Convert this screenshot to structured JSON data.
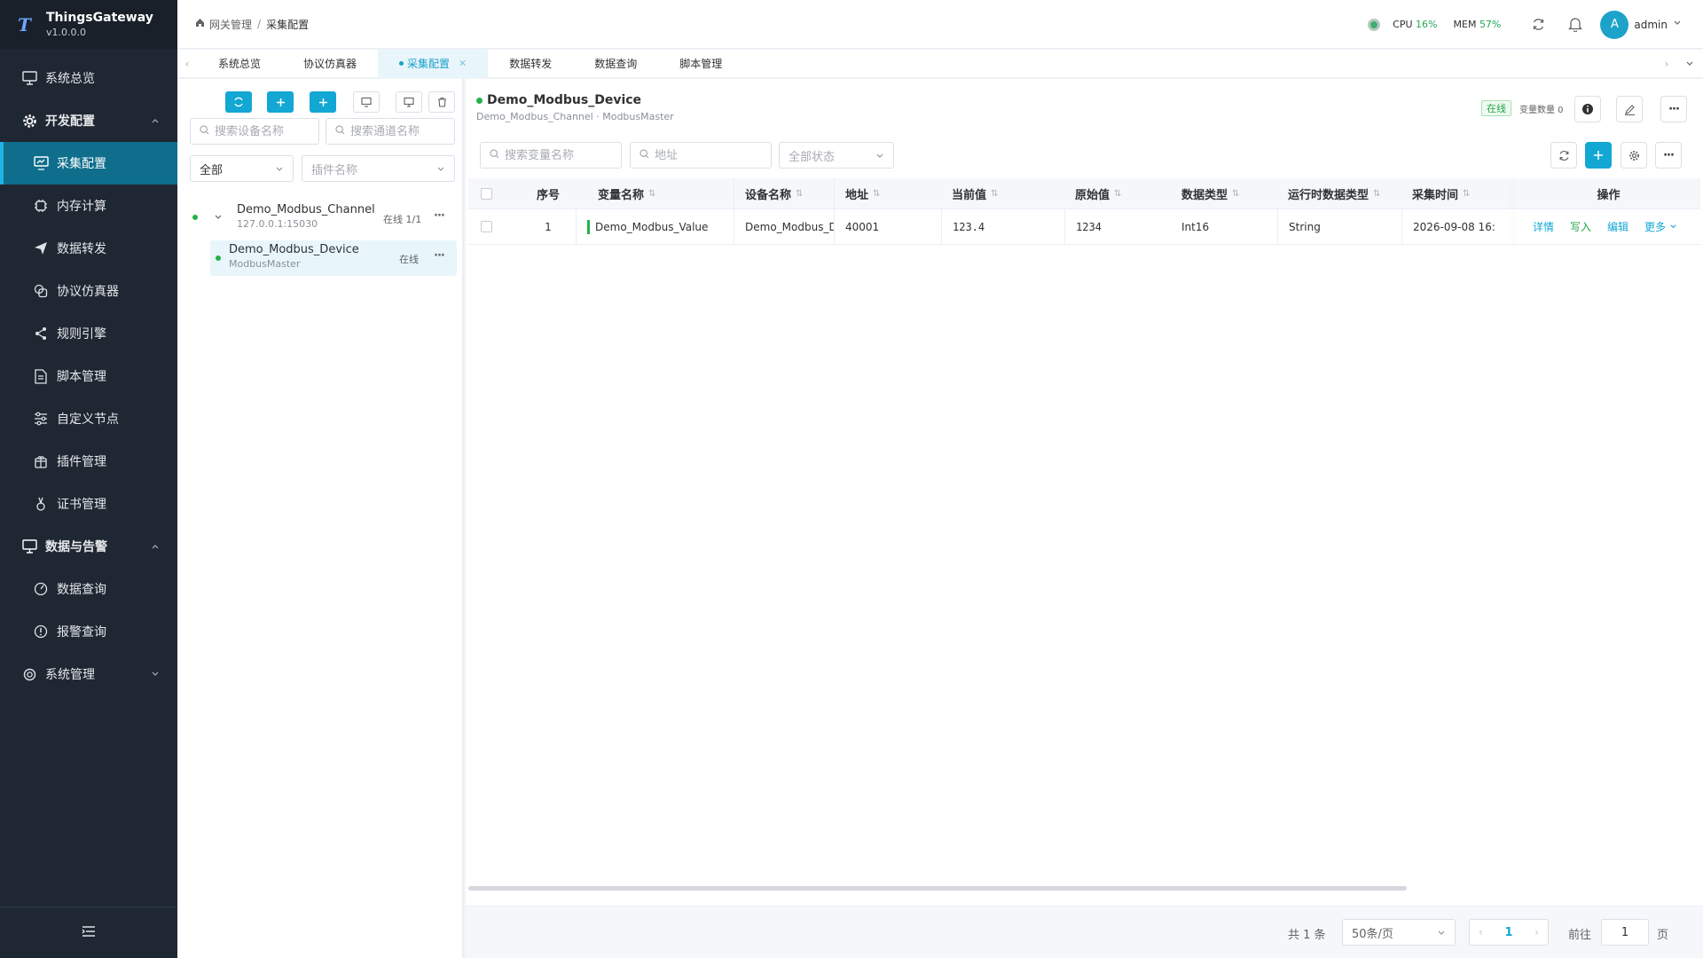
{
  "app": {
    "name": "ThingsGateway",
    "version": "v1.0.0.0"
  },
  "sidebar": {
    "items": [
      {
        "label": "系统总览",
        "icon": "monitor-icon"
      },
      {
        "label": "开发配置",
        "icon": "gear-icon"
      },
      {
        "label": "采集配置",
        "icon": "monitor-icon"
      },
      {
        "label": "内存计算",
        "icon": "chip-icon"
      },
      {
        "label": "数据转发",
        "icon": "send-icon"
      },
      {
        "label": "协议仿真器",
        "icon": "layers-icon"
      },
      {
        "label": "规则引擎",
        "icon": "share-icon"
      },
      {
        "label": "脚本管理",
        "icon": "file-icon"
      },
      {
        "label": "自定义节点",
        "icon": "sliders-icon"
      },
      {
        "label": "插件管理",
        "icon": "gift-icon"
      },
      {
        "label": "证书管理",
        "icon": "certificate-icon"
      },
      {
        "label": "数据与告警",
        "icon": "chart-icon"
      },
      {
        "label": "数据查询",
        "icon": "gauge-icon"
      },
      {
        "label": "报警查询",
        "icon": "alert-icon"
      },
      {
        "label": "系统管理",
        "icon": "gear-icon"
      }
    ]
  },
  "header": {
    "breadcrumb": [
      "网关管理",
      "采集配置"
    ],
    "cpu_label": "CPU",
    "cpu_value": "16%",
    "mem_label": "MEM",
    "mem_value": "57%",
    "avatar_letter": "A",
    "user": "admin"
  },
  "tabs": [
    {
      "label": "系统总览"
    },
    {
      "label": "协议仿真器"
    },
    {
      "label": "采集配置"
    },
    {
      "label": "数据转发"
    },
    {
      "label": "数据查询"
    },
    {
      "label": "脚本管理"
    }
  ],
  "left_panel": {
    "search_device_placeholder": "搜索设备名称",
    "search_channel_placeholder": "搜索通道名称",
    "filter_all": "全部",
    "plugin_placeholder": "插件名称",
    "channel": {
      "name": "Demo_Modbus_Channel",
      "address": "127.0.0.1:15030",
      "status": "在线 1/1"
    },
    "device": {
      "name": "Demo_Modbus_Device",
      "plugin": "ModbusMaster",
      "status": "在线"
    }
  },
  "main": {
    "device_title": "Demo_Modbus_Device",
    "device_sub": "Demo_Modbus_Channel · ModbusMaster",
    "online_tag": "在线",
    "var_count": "变量数量 0",
    "search_var_placeholder": "搜索变量名称",
    "address_placeholder": "地址",
    "status_filter": "全部状态",
    "columns": [
      "序号",
      "变量名称",
      "设备名称",
      "地址",
      "当前值",
      "原始值",
      "数据类型",
      "运行时数据类型",
      "采集时间",
      "操作"
    ],
    "rows": [
      {
        "index": "1",
        "name": "Demo_Modbus_Value",
        "device": "Demo_Modbus_D...",
        "address": "40001",
        "current": "123.4",
        "raw": "1234",
        "dtype": "Int16",
        "runtime_type": "String",
        "time": "2026-09-08 16:"
      }
    ],
    "actions": {
      "detail": "详情",
      "write": "写入",
      "edit": "编辑",
      "more": "更多"
    }
  },
  "pagination": {
    "total": "共 1 条",
    "page_size": "50条/页",
    "current": "1",
    "goto_label": "前往",
    "goto_value": "1",
    "page_unit": "页"
  },
  "colors": {
    "accent": "#13a7d3",
    "online": "#22b24c",
    "sidebar_bg": "#1f2733"
  }
}
